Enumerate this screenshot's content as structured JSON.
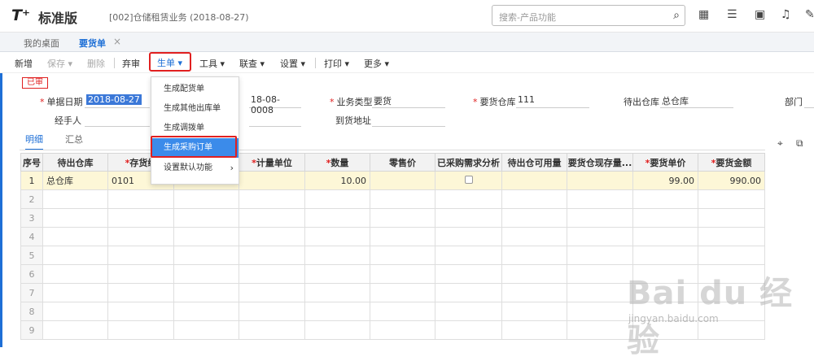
{
  "app": {
    "logo": "T⁺",
    "edition": "标准版",
    "account": "[002]仓储租赁业务  (2018-08-27)"
  },
  "search": {
    "placeholder": "搜索-产品功能"
  },
  "tabs": [
    {
      "label": "我的桌面"
    },
    {
      "label": "要货单"
    }
  ],
  "toolbar": {
    "new": "新增",
    "save": "保存",
    "delete": "删除",
    "unapprove": "弃审",
    "generate": "生单",
    "tools": "工具",
    "query": "联查",
    "settings": "设置",
    "print": "打印",
    "more": "更多"
  },
  "status": "已审",
  "form": {
    "doc_date_label": "单据日期",
    "doc_date": "2018-08-27",
    "doc_no_partial": "18-08-0008",
    "biz_type_label": "业务类型",
    "biz_type": "要货",
    "req_wh_label": "要货仓库",
    "req_wh": "111",
    "out_wh_label": "待出仓库",
    "out_wh": "总仓库",
    "dept_label": "部门",
    "handler_label": "经手人",
    "address_label": "到货地址"
  },
  "subtabs": [
    "明细",
    "汇总"
  ],
  "menu": {
    "items": [
      {
        "label": "生成配货单"
      },
      {
        "label": "生成其他出库单"
      },
      {
        "label": "生成调拨单"
      },
      {
        "label": "生成采购订单"
      },
      {
        "label": "设置默认功能"
      }
    ]
  },
  "grid": {
    "headers": [
      "序号",
      "待出仓库",
      "存货编",
      "",
      "计量单位",
      "数量",
      "零售价",
      "已采购需求分析",
      "待出仓可用量",
      "要货仓现存量...",
      "要货单价",
      "要货金额"
    ],
    "row1": {
      "idx": "1",
      "warehouse": "总仓库",
      "code": "0101",
      "qty": "10.00",
      "price": "99.00",
      "amount": "990.00"
    },
    "empty_rows": [
      "2",
      "3",
      "4",
      "5",
      "6",
      "7",
      "8",
      "9"
    ]
  },
  "watermark": {
    "brand": "Bai du 经验",
    "url": "jingyan.baidu.com"
  }
}
